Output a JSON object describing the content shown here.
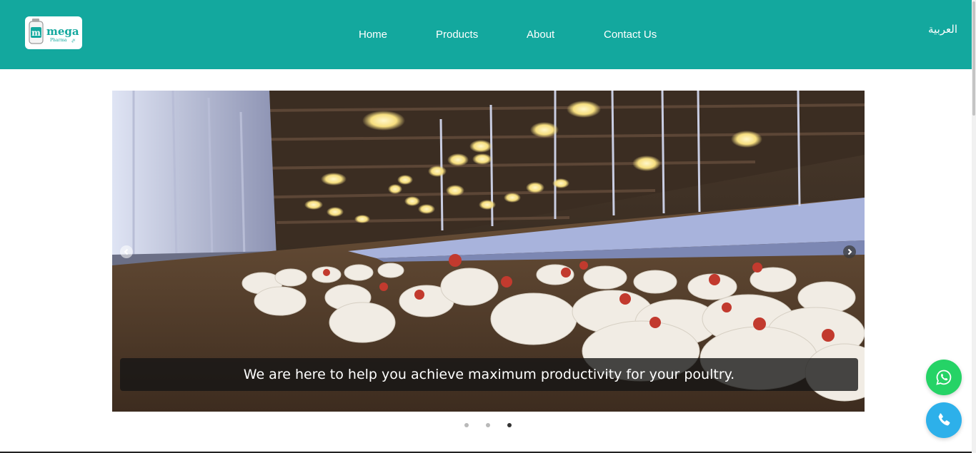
{
  "brand": {
    "logo_word": "mega",
    "logo_sub": "Pharma",
    "logo_sub2": "eg.",
    "logo_letter": "m",
    "color": "#13a89e"
  },
  "nav": {
    "items": [
      {
        "label": "Home"
      },
      {
        "label": "Products"
      },
      {
        "label": "About"
      },
      {
        "label": "Contact Us"
      }
    ],
    "language": "العربية"
  },
  "carousel": {
    "caption": "We are here to help you achieve maximum productivity for your poultry.",
    "slide_count": 3,
    "active_slide": 3,
    "prev_icon": "chevron-left-icon",
    "next_icon": "chevron-right-icon"
  },
  "contact_buttons": {
    "whatsapp_icon": "whatsapp-icon",
    "whatsapp_color": "#25d366",
    "phone_icon": "phone-icon",
    "phone_color": "#2db0ea"
  }
}
